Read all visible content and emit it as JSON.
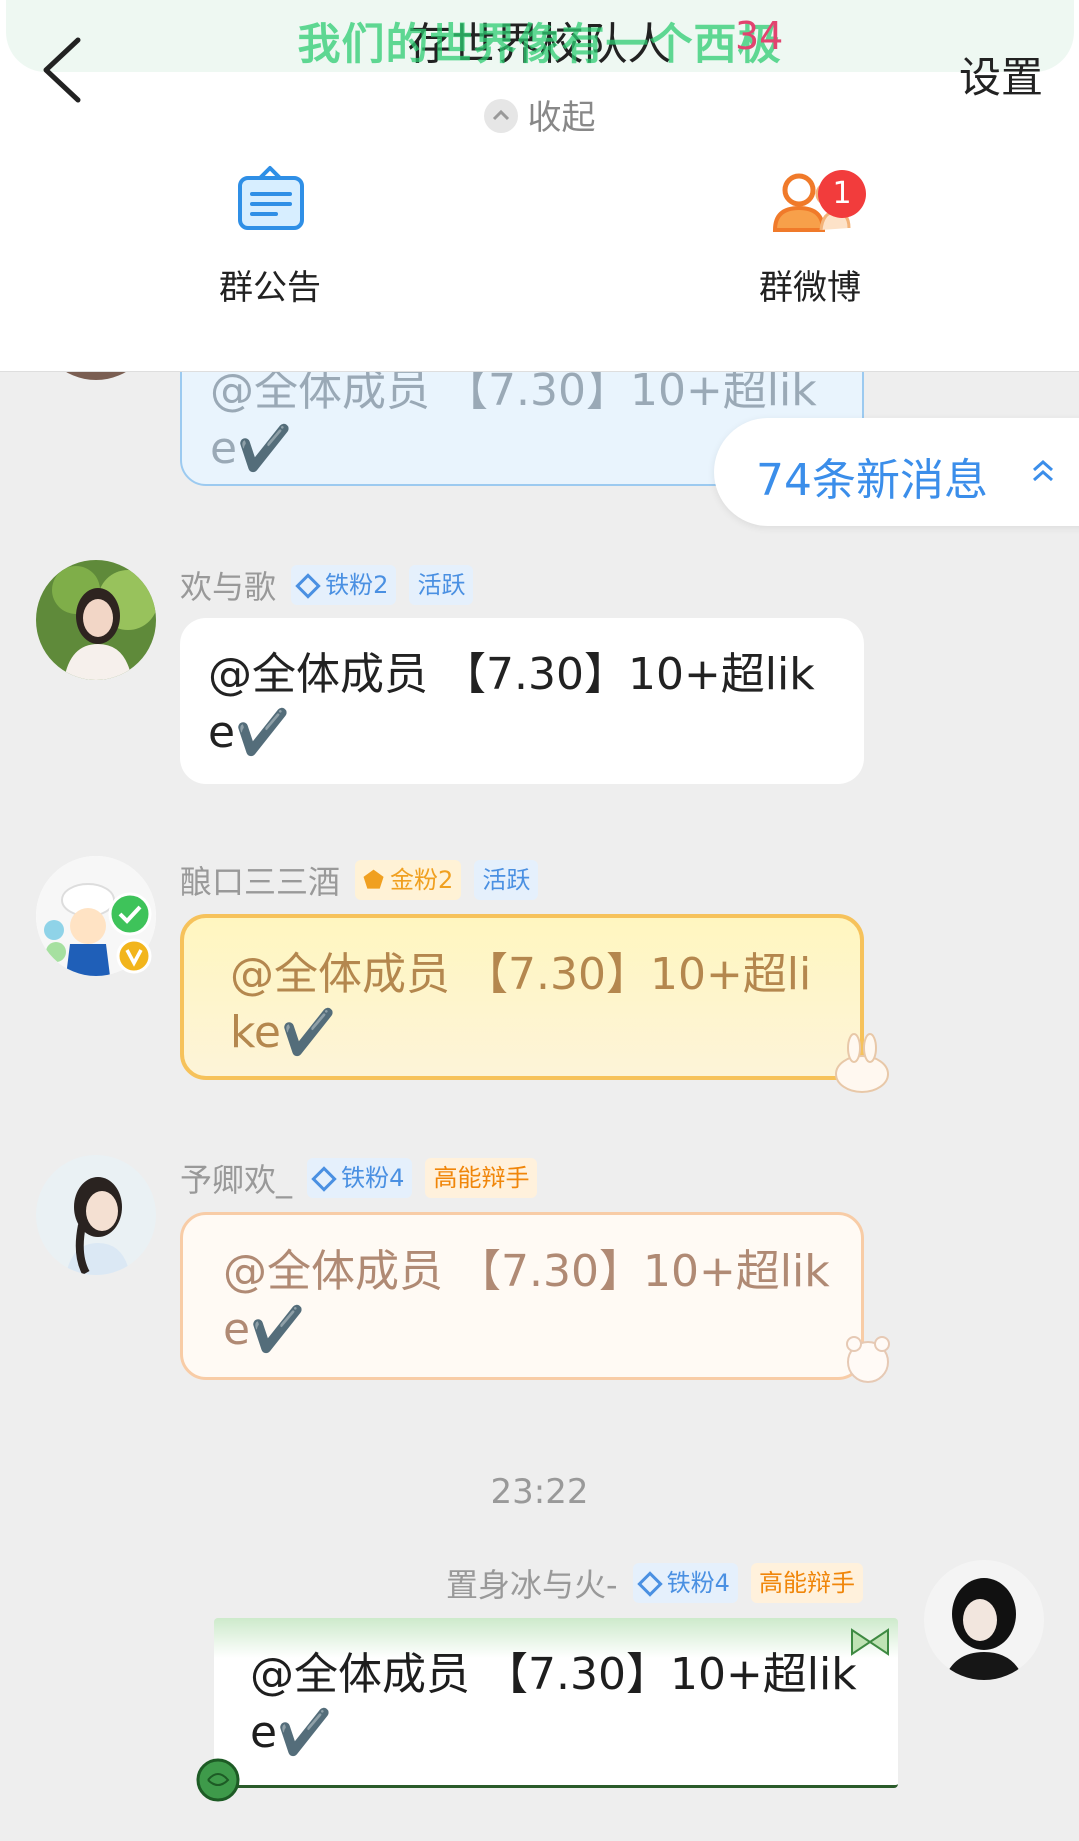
{
  "header": {
    "group_title": "存世界校队人",
    "marquee": "我们的世界像有一个西极",
    "member_count": "34",
    "settings_label": "设置",
    "collapse_label": "收起",
    "tools": [
      {
        "label": "群公告",
        "icon": "announcement-icon"
      },
      {
        "label": "群微博",
        "icon": "group-weibo-icon",
        "badge": "1"
      }
    ]
  },
  "new_messages": {
    "label": "74条新消息",
    "icon": "chevron-up-double-icon"
  },
  "messages": [
    {
      "text": "@全体成员 【7.30】10+超like✔️",
      "style": "blue"
    },
    {
      "sender": "欢与歌",
      "fan_tag": "铁粉2",
      "title_tag": "活跃",
      "text": "@全体成员 【7.30】10+超like✔️",
      "style": "plain"
    },
    {
      "sender": "酿口三三酒",
      "fan_tag": "金粉2",
      "title_tag": "活跃",
      "text": "@全体成员 【7.30】10+超like✔️",
      "style": "yellow"
    },
    {
      "sender": "予卿欢_",
      "fan_tag": "铁粉4",
      "title_tag": "高能辩手",
      "text": "@全体成员 【7.30】10+超like✔️",
      "style": "peach"
    }
  ],
  "timestamp": "23:22",
  "my_message": {
    "sender": "置身冰与火-",
    "fan_tag": "铁粉4",
    "title_tag": "高能辩手",
    "text": "@全体成员 【7.30】10+超like✔️"
  },
  "colors": {
    "accent_blue": "#3b8eea",
    "badge_red": "#f23c3c",
    "marquee_green": "#2ecc71",
    "gold": "#f0a020"
  }
}
